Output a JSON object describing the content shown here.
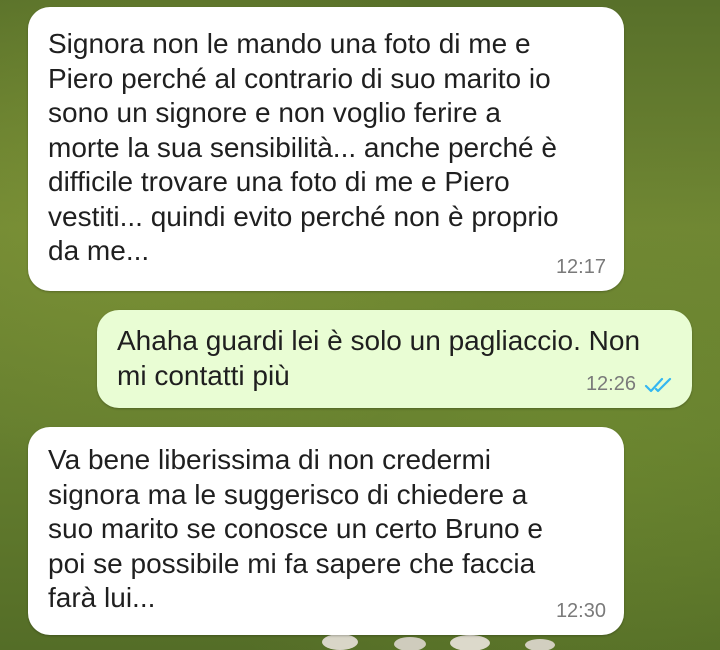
{
  "colors": {
    "incoming_bubble": "#ffffff",
    "outgoing_bubble": "#e9fdd4",
    "read_tick": "#34b7f1"
  },
  "messages": [
    {
      "direction": "incoming",
      "text": "Signora non le mando una foto di me e\nPiero perché al contrario di suo marito io\nsono un signore e non voglio ferire a\nmorte la sua sensibilità... anche perché è\ndifficile trovare una foto di me e Piero\nvestiti... quindi evito perché non è proprio\nda me...",
      "time": "12:17"
    },
    {
      "direction": "outgoing",
      "text": "Ahaha guardi lei è solo un pagliaccio. Non\nmi contatti più",
      "time": "12:26",
      "status_icon": "double-check-read-icon"
    },
    {
      "direction": "incoming",
      "text": "Va bene liberissima di non credermi\nsignora ma le suggerisco di chiedere a\nsuo marito se conosce un certo Bruno e\npoi se possibile mi fa sapere che faccia\nfarà lui...",
      "time": "12:30"
    }
  ]
}
